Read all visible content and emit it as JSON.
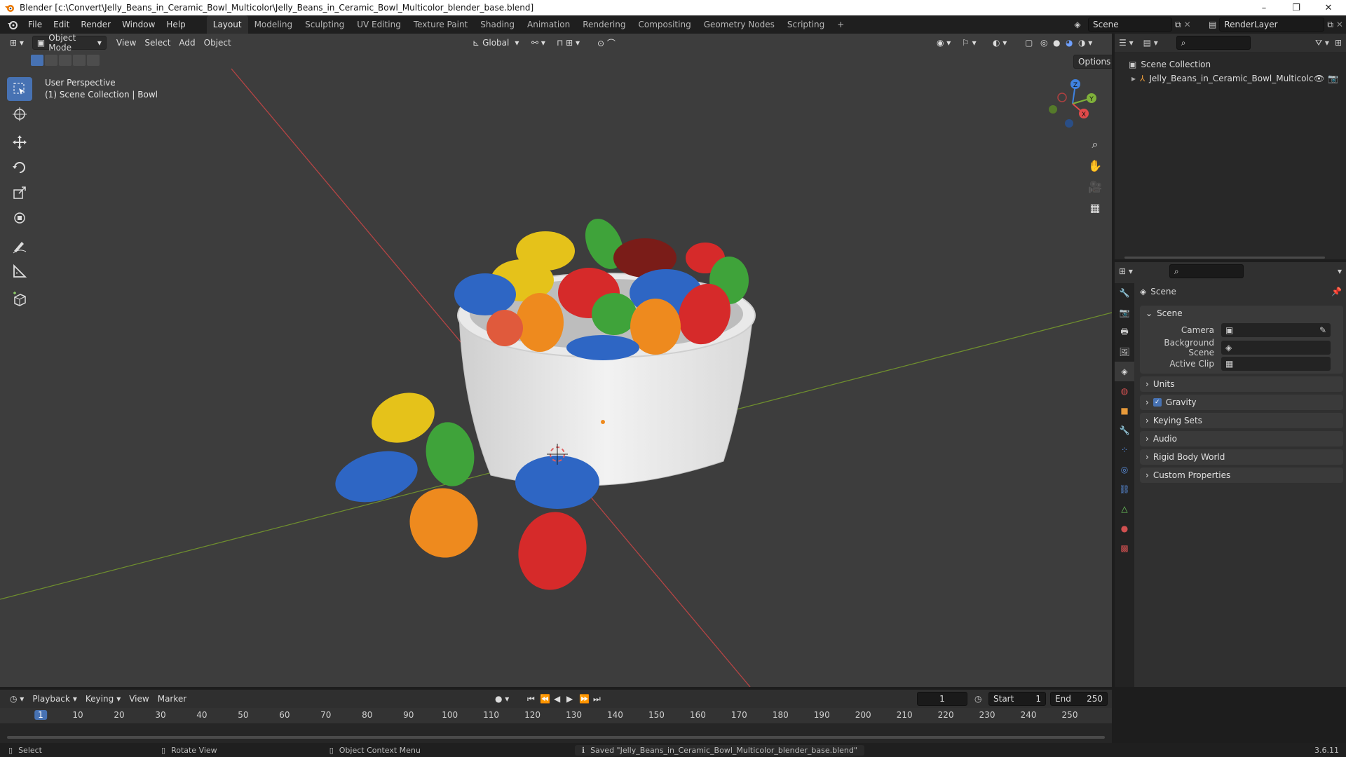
{
  "window": {
    "title": "Blender [c:\\Convert\\Jelly_Beans_in_Ceramic_Bowl_Multicolor\\Jelly_Beans_in_Ceramic_Bowl_Multicolor_blender_base.blend]",
    "minimize": "–",
    "maximize": "❐",
    "close": "✕"
  },
  "menu": [
    "File",
    "Edit",
    "Render",
    "Window",
    "Help"
  ],
  "workspaces": [
    "Layout",
    "Modeling",
    "Sculpting",
    "UV Editing",
    "Texture Paint",
    "Shading",
    "Animation",
    "Rendering",
    "Compositing",
    "Geometry Nodes",
    "Scripting",
    "+"
  ],
  "active_workspace": "Layout",
  "scene_field": "Scene",
  "view_layer_field": "RenderLayer",
  "viewport": {
    "mode": "Object Mode",
    "menus": [
      "View",
      "Select",
      "Add",
      "Object"
    ],
    "transform_orientation": "Global",
    "options_label": "Options",
    "info_line1": "User Perspective",
    "info_line2": "(1) Scene Collection | Bowl",
    "gizmo_axes": {
      "x": "X",
      "y": "Y",
      "z": "Z"
    }
  },
  "outliner": {
    "root": "Scene Collection",
    "items": [
      {
        "label": "Jelly_Beans_in_Ceramic_Bowl_Multicolc"
      }
    ]
  },
  "properties": {
    "context_title": "Scene",
    "scene_panel": {
      "title": "Scene",
      "rows": [
        {
          "label": "Camera"
        },
        {
          "label": "Background Scene"
        },
        {
          "label": "Active Clip"
        }
      ]
    },
    "panels": [
      "Units",
      "Gravity",
      "Keying Sets",
      "Audio",
      "Rigid Body World",
      "Custom Properties"
    ]
  },
  "timeline": {
    "menus": [
      "Playback",
      "Keying",
      "View",
      "Marker"
    ],
    "current_frame": "1",
    "start_label": "Start",
    "start": "1",
    "end_label": "End",
    "end": "250",
    "ticks": [
      "1",
      "10",
      "20",
      "30",
      "40",
      "50",
      "60",
      "70",
      "80",
      "90",
      "100",
      "110",
      "120",
      "130",
      "140",
      "150",
      "160",
      "170",
      "180",
      "190",
      "200",
      "210",
      "220",
      "230",
      "240",
      "250"
    ]
  },
  "statusbar": {
    "select": "Select",
    "rotate": "Rotate View",
    "context_menu": "Object Context Menu",
    "message": "Saved \"Jelly_Beans_in_Ceramic_Bowl_Multicolor_blender_base.blend\"",
    "version": "3.6.11"
  },
  "colors": {
    "accent": "#4772b3",
    "x_axis": "#e04a4a",
    "y_axis": "#7fb03a",
    "z_axis": "#3f82e0"
  }
}
